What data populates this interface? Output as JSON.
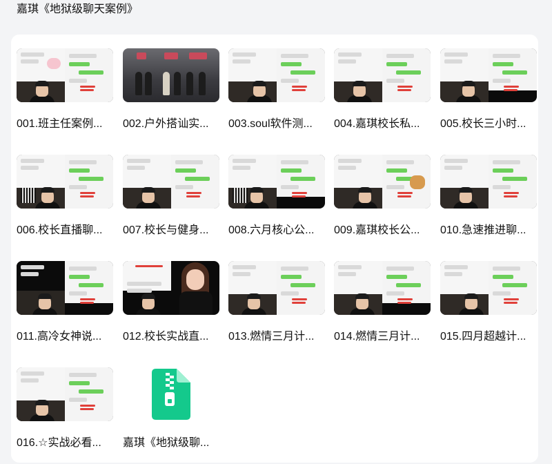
{
  "page": {
    "title": "嘉琪《地狱级聊天案例》"
  },
  "colors": {
    "background": "#f3f4f6",
    "panel": "#ffffff",
    "zip_icon": "#14c98c",
    "chat_green": "#6ccf5a"
  },
  "files": [
    {
      "label": "001.班主任案例...",
      "type": "video",
      "thumb": "chat-pink"
    },
    {
      "label": "002.户外搭讪实...",
      "type": "video",
      "thumb": "street"
    },
    {
      "label": "003.soul软件测...",
      "type": "video",
      "thumb": "chat"
    },
    {
      "label": "004.嘉琪校长私...",
      "type": "video",
      "thumb": "chat"
    },
    {
      "label": "005.校长三小时...",
      "type": "video",
      "thumb": "chat"
    },
    {
      "label": "006.校长直播聊...",
      "type": "video",
      "thumb": "chat-qr"
    },
    {
      "label": "007.校长与健身...",
      "type": "video",
      "thumb": "chat"
    },
    {
      "label": "008.六月核心公...",
      "type": "video",
      "thumb": "chat-qr"
    },
    {
      "label": "009.嘉琪校长公...",
      "type": "video",
      "thumb": "dog"
    },
    {
      "label": "010.急速推进聊...",
      "type": "video",
      "thumb": "chat"
    },
    {
      "label": "011.高冷女神说...",
      "type": "video",
      "thumb": "chat-dark"
    },
    {
      "label": "012.校长实战直...",
      "type": "video",
      "thumb": "woman"
    },
    {
      "label": "013.燃情三月计...",
      "type": "video",
      "thumb": "chat"
    },
    {
      "label": "014.燃情三月计...",
      "type": "video",
      "thumb": "chat"
    },
    {
      "label": "015.四月超越计...",
      "type": "video",
      "thumb": "chat"
    },
    {
      "label": "016.☆实战必看...",
      "type": "video",
      "thumb": "chat"
    },
    {
      "label": "嘉琪《地狱级聊...",
      "type": "zip",
      "icon": "zip-file-icon"
    }
  ]
}
